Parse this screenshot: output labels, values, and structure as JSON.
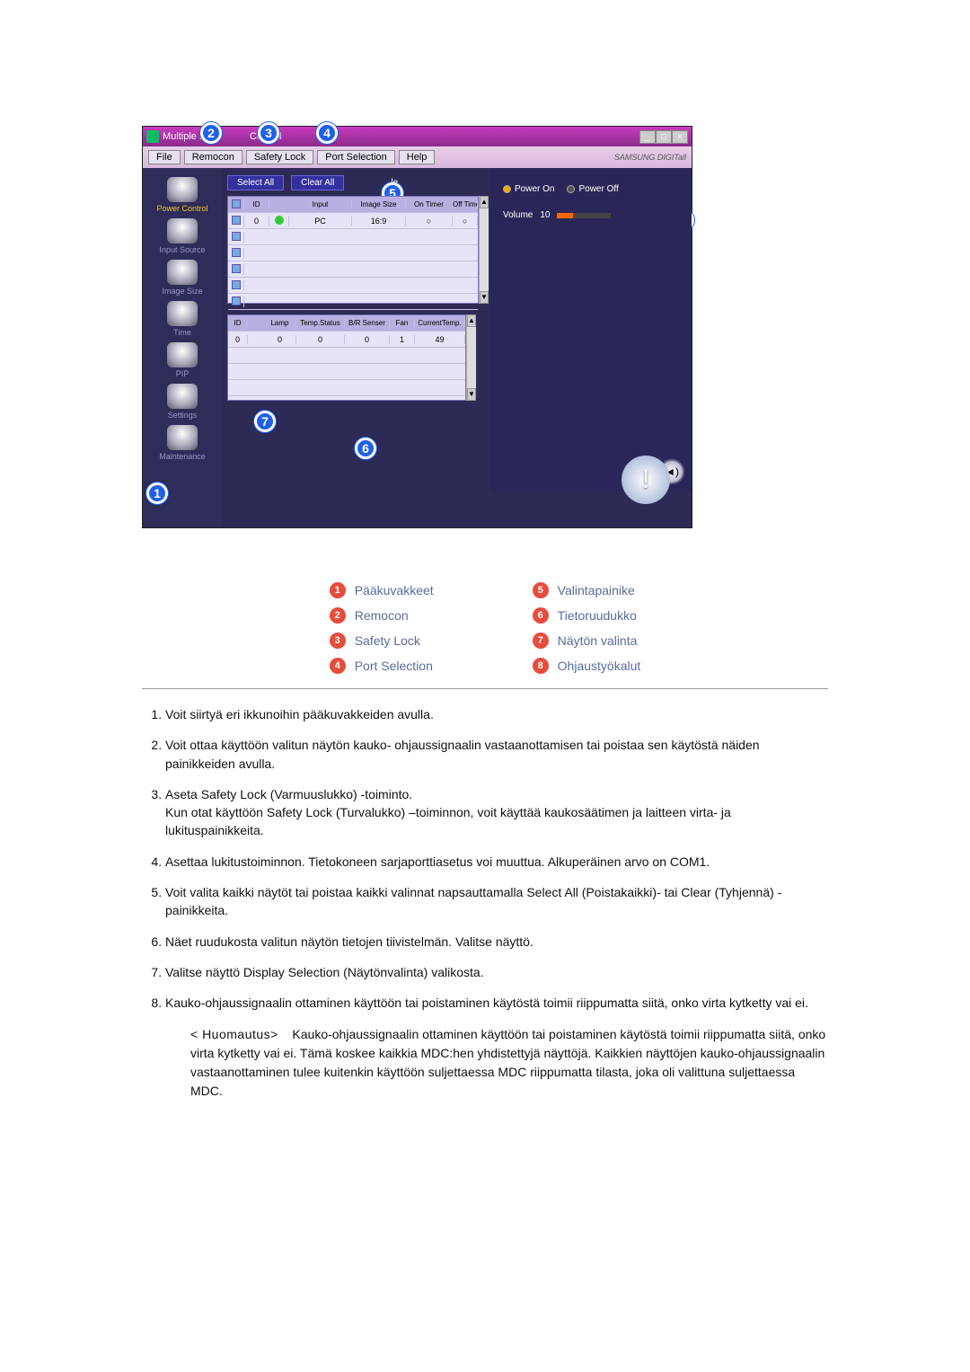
{
  "window": {
    "title_left": "Multiple D",
    "title_right": "Control",
    "menu": {
      "file": "File",
      "remocon": "Remocon",
      "safety": "Safety Lock",
      "port": "Port Selection",
      "help": "Help"
    },
    "brand": "SAMSUNG DIGITall",
    "win_min": "_",
    "win_max": "□",
    "win_close": "×"
  },
  "sidebar": {
    "items": [
      {
        "label": "Power Control"
      },
      {
        "label": "Input Source"
      },
      {
        "label": "Image Size"
      },
      {
        "label": "Time"
      },
      {
        "label": "PIP"
      },
      {
        "label": "Settings"
      },
      {
        "label": "Maintenance"
      }
    ]
  },
  "toolbar": {
    "select_all": "Select All",
    "clear_all": "Clear All",
    "le": "le"
  },
  "top_grid": {
    "headers": {
      "id": "ID",
      "pw": "",
      "input": "Input",
      "isize": "Image Size",
      "ontimer": "On Timer",
      "offtimer": "Off Timer"
    },
    "row": {
      "id": "0",
      "input": "PC",
      "isize": "16:9",
      "ontimer": "○",
      "offtimer": "○"
    }
  },
  "bot_grid": {
    "headers": {
      "id": "ID",
      "lamp": "Lamp",
      "temp": "Temp.Status",
      "bs": "B/R Senser",
      "fan": "Fan",
      "ct": "CurrentTemp."
    },
    "row": {
      "id": "0",
      "lamp": "0",
      "temp": "0",
      "bs": "0",
      "fan": "1",
      "ct": "49"
    }
  },
  "right": {
    "power_on": "Power On",
    "power_off": "Power Off",
    "volume_label": "Volume",
    "volume_value": "10"
  },
  "callouts": {
    "1": "1",
    "2": "2",
    "3": "3",
    "4": "4",
    "5": "5",
    "6": "6",
    "7": "7",
    "8": "8"
  },
  "legend": {
    "l1": "Pääkuvakkeet",
    "l2": "Remocon",
    "l3": "Safety Lock",
    "l4": "Port Selection",
    "l5": "Valintapainike",
    "l6": "Tietoruudukko",
    "l7": "Näytön valinta",
    "l8": "Ohjaustyökalut"
  },
  "list": {
    "i1": "Voit siirtyä eri ikkunoihin pääkuvakkeiden avulla.",
    "i2": "Voit ottaa käyttöön valitun näytön kauko- ohjaussignaalin vastaanottamisen tai poistaa sen käytöstä näiden painikkeiden avulla.",
    "i3a": "Aseta Safety Lock (Varmuuslukko) -toiminto.",
    "i3b": "Kun otat käyttöön Safety Lock (Turvalukko) –toiminnon, voit käyttää kaukosäätimen ja laitteen virta- ja lukituspainikkeita.",
    "i4": "Asettaa lukitustoiminnon. Tietokoneen sarjaporttiasetus voi muuttua. Alkuperäinen arvo on COM1.",
    "i5": "Voit valita kaikki näytöt tai poistaa kaikki valinnat napsauttamalla Select All (Poistakaikki)- tai Clear (Tyhjennä) -painikkeita.",
    "i6": "Näet ruudukosta valitun näytön tietojen tiivistelmän. Valitse näyttö.",
    "i7": "Valitse näyttö Display Selection (Näytönvalinta) valikosta.",
    "i8": "Kauko-ohjaussignaalin ottaminen käyttöön tai poistaminen käytöstä toimii riippumatta siitä, onko virta kytketty vai ei."
  },
  "note": {
    "label": "< Huomautus>",
    "text": "Kauko-ohjaussignaalin ottaminen käyttöön tai poistaminen käytöstä toimii riippumatta siitä, onko virta kytketty vai ei. Tämä koskee kaikkia MDC:hen yhdistettyjä näyttöjä. Kaikkien näyttöjen kauko-ohjaussignaalin vastaanottaminen tulee kuitenkin käyttöön suljettaessa MDC riippumatta tilasta, joka oli valittuna suljettaessa MDC."
  }
}
